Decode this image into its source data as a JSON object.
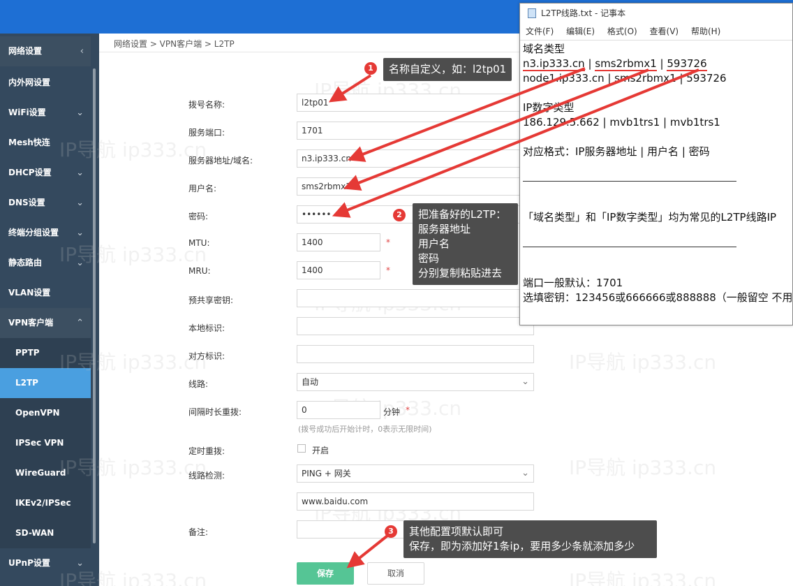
{
  "breadcrumb": "网络设置 > VPN客户端 > L2TP",
  "sidebar": {
    "items": [
      {
        "label": "网络设置",
        "chevron": "‹"
      },
      {
        "label": "内外网设置",
        "chevron": ""
      },
      {
        "label": "WiFi设置",
        "chevron": "⌄"
      },
      {
        "label": "Mesh快连",
        "chevron": ""
      },
      {
        "label": "DHCP设置",
        "chevron": "⌄"
      },
      {
        "label": "DNS设置",
        "chevron": "⌄"
      },
      {
        "label": "终端分组设置",
        "chevron": "⌄"
      },
      {
        "label": "静态路由",
        "chevron": "⌄"
      },
      {
        "label": "VLAN设置",
        "chevron": ""
      },
      {
        "label": "VPN客户端",
        "chevron": "⌃"
      },
      {
        "label": "PPTP",
        "chevron": ""
      },
      {
        "label": "L2TP",
        "chevron": ""
      },
      {
        "label": "OpenVPN",
        "chevron": ""
      },
      {
        "label": "IPSec VPN",
        "chevron": ""
      },
      {
        "label": "WireGuard",
        "chevron": ""
      },
      {
        "label": "IKEv2/IPSec",
        "chevron": ""
      },
      {
        "label": "SD-WAN",
        "chevron": ""
      },
      {
        "label": "UPnP设置",
        "chevron": "⌄"
      }
    ]
  },
  "form": {
    "dial_name": {
      "label": "拨号名称:",
      "value": "l2tp01"
    },
    "port": {
      "label": "服务端口:",
      "value": "1701"
    },
    "server": {
      "label": "服务器地址/域名:",
      "value": "n3.ip333.cn"
    },
    "username": {
      "label": "用户名:",
      "value": "sms2rbmx1"
    },
    "password": {
      "label": "密码:",
      "value": "••••••"
    },
    "mtu": {
      "label": "MTU:",
      "value": "1400"
    },
    "mru": {
      "label": "MRU:",
      "value": "1400"
    },
    "psk": {
      "label": "预共享密钥:",
      "value": ""
    },
    "local_id": {
      "label": "本地标识:",
      "value": ""
    },
    "remote_id": {
      "label": "对方标识:",
      "value": ""
    },
    "line": {
      "label": "线路:",
      "value": "自动"
    },
    "redial_interval": {
      "label": "间隔时长重拨:",
      "value": "0",
      "unit": "分钟",
      "hint": "(拨号成功后开始计时，0表示无限时间)"
    },
    "timed_redial": {
      "label": "定时重拨:",
      "option": "开启"
    },
    "line_check": {
      "label": "线路检测:",
      "value": "PING + 网关",
      "target": "www.baidu.com"
    },
    "remark": {
      "label": "备注:",
      "value": ""
    },
    "required_mark": "*",
    "save_label": "保存",
    "cancel_label": "取消"
  },
  "watermark": "IP导航  ip333.cn",
  "callouts": {
    "c1": {
      "num": "1",
      "text": "名称自定义，如：l2tp01"
    },
    "c2": {
      "num": "2",
      "lines": [
        "把准备好的L2TP：",
        "服务器地址",
        "用户名",
        "密码",
        "分别复制粘贴进去"
      ]
    },
    "c3": {
      "num": "3",
      "lines": [
        "其他配置项默认即可",
        "保存，即为添加好1条ip，要用多少条就添加多少"
      ]
    }
  },
  "notepad": {
    "title": "L2TP线路.txt - 记事本",
    "menu": [
      "文件(F)",
      "编辑(E)",
      "格式(O)",
      "查看(V)",
      "帮助(H)"
    ],
    "line1": "域名类型",
    "line2_a": "n3.ip333.cn",
    "line2_b": "sms2rbmx1",
    "line2_c": "593726",
    "sep": " | ",
    "line3": "node1.ip333.cn | sms2rbmx1 | 593726",
    "line5": "IP数字类型",
    "line6": "186.129.5.662 | mvb1trs1 | mvb1trs1",
    "line8": "对应格式：IP服务器地址 | 用户名 | 密码",
    "line11": "「域名类型」和「IP数字类型」均为常见的L2TP线路IP",
    "line15": "端口一般默认：1701",
    "line16": "选填密钥：123456或666666或888888（一般留空 不用"
  }
}
